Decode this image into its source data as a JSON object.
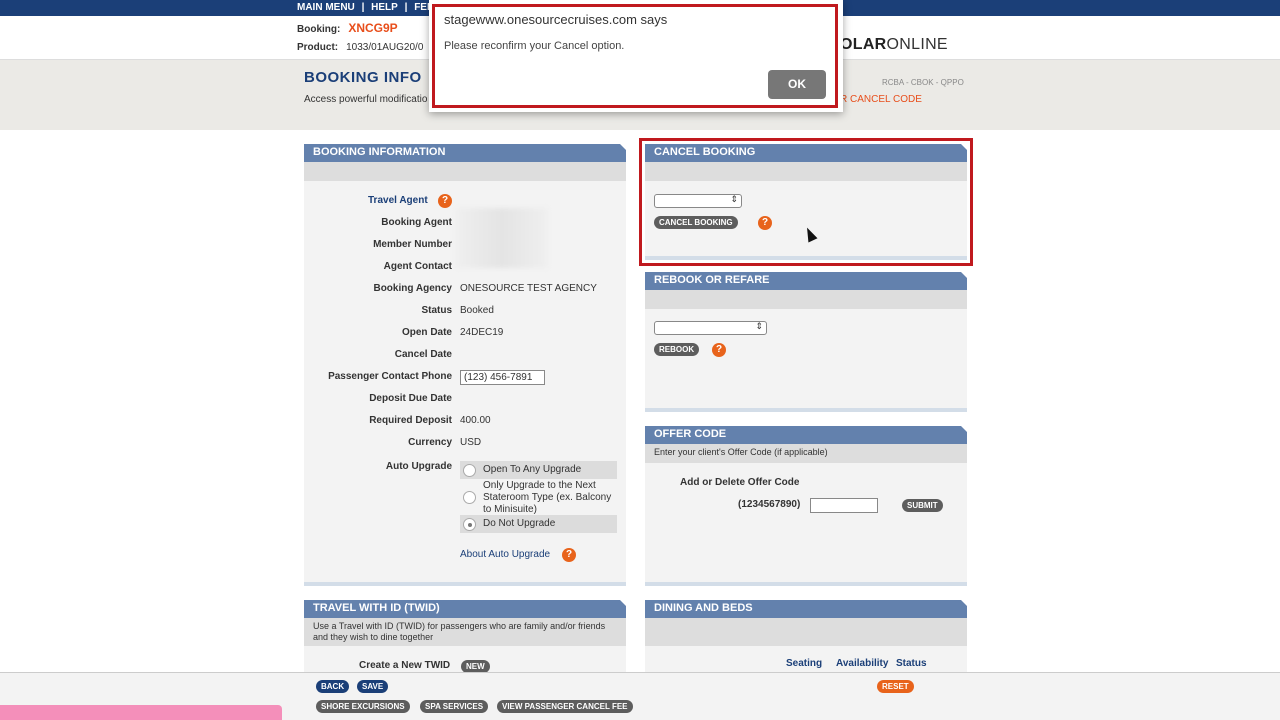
{
  "topnav": {
    "items": [
      "MAIN MENU",
      "|",
      "HELP",
      "|",
      "FEE"
    ]
  },
  "header": {
    "booking_label": "Booking:",
    "booking_value": "XNCG9P",
    "product_label": "Product:",
    "product_value": "1033/01AUG20/0",
    "brand_bold": "OLAR",
    "brand_rest": "ONLINE"
  },
  "infobar": {
    "title": "BOOKING INFO",
    "subtitle": "Access powerful modificatio",
    "codes": "RCBA - CBOK - QPPO",
    "cancel_code": "R CANCEL CODE"
  },
  "booking_info": {
    "title": "BOOKING INFORMATION",
    "travel_agent_link": "Travel Agent",
    "fields": [
      {
        "label": "Booking Agent",
        "value": ""
      },
      {
        "label": "Member Number",
        "value": ""
      },
      {
        "label": "Agent Contact",
        "value": ""
      },
      {
        "label": "Booking Agency",
        "value": "ONESOURCE TEST AGENCY"
      },
      {
        "label": "Status",
        "value": "Booked"
      },
      {
        "label": "Open Date",
        "value": "24DEC19"
      },
      {
        "label": "Cancel Date",
        "value": ""
      },
      {
        "label": "Passenger Contact Phone",
        "value": "(123) 456-7891"
      },
      {
        "label": "Deposit Due Date",
        "value": ""
      },
      {
        "label": "Required Deposit",
        "value": "400.00"
      },
      {
        "label": "Currency",
        "value": "USD"
      }
    ],
    "auto_upgrade_label": "Auto Upgrade",
    "upgrade_options": [
      "Open To Any Upgrade",
      "Only Upgrade to the Next Stateroom Type (ex. Balcony to Minisuite)",
      "Do Not Upgrade"
    ],
    "upgrade_selected": "Do Not Upgrade",
    "about_link": "About Auto Upgrade"
  },
  "cancel_booking": {
    "title": "CANCEL BOOKING",
    "select_value": "",
    "button": "CANCEL BOOKING"
  },
  "rebook": {
    "title": "REBOOK OR REFARE",
    "select_value": "",
    "button": "REBOOK"
  },
  "offer_code": {
    "title": "OFFER CODE",
    "subtitle": "Enter your client's Offer Code (if applicable)",
    "add_label": "Add or Delete Offer Code",
    "format": "(1234567890)",
    "input_value": "",
    "button": "SUBMIT"
  },
  "twid": {
    "title": "TRAVEL WITH ID (TWID)",
    "subtitle": "Use a Travel with ID (TWID) for passengers who are family and/or friends and they wish to dine together",
    "create_label": "Create a New TWID",
    "new_button": "NEW"
  },
  "dining": {
    "title": "DINING AND BEDS",
    "columns": [
      "Seating",
      "Availability",
      "Status"
    ]
  },
  "footer": {
    "back": "BACK",
    "save": "SAVE",
    "reset": "RESET",
    "shore": "SHORE EXCURSIONS",
    "spa": "SPA SERVICES",
    "cancel_fee": "VIEW PASSENGER CANCEL FEE"
  },
  "dialog": {
    "title": "stagewww.onesourcecruises.com says",
    "message": "Please reconfirm your Cancel option.",
    "ok": "OK"
  },
  "colors": {
    "navy": "#1b3f78",
    "panel_header": "#6381ad",
    "accent_orange": "#e84e1b",
    "highlight_red": "#c0191e"
  }
}
